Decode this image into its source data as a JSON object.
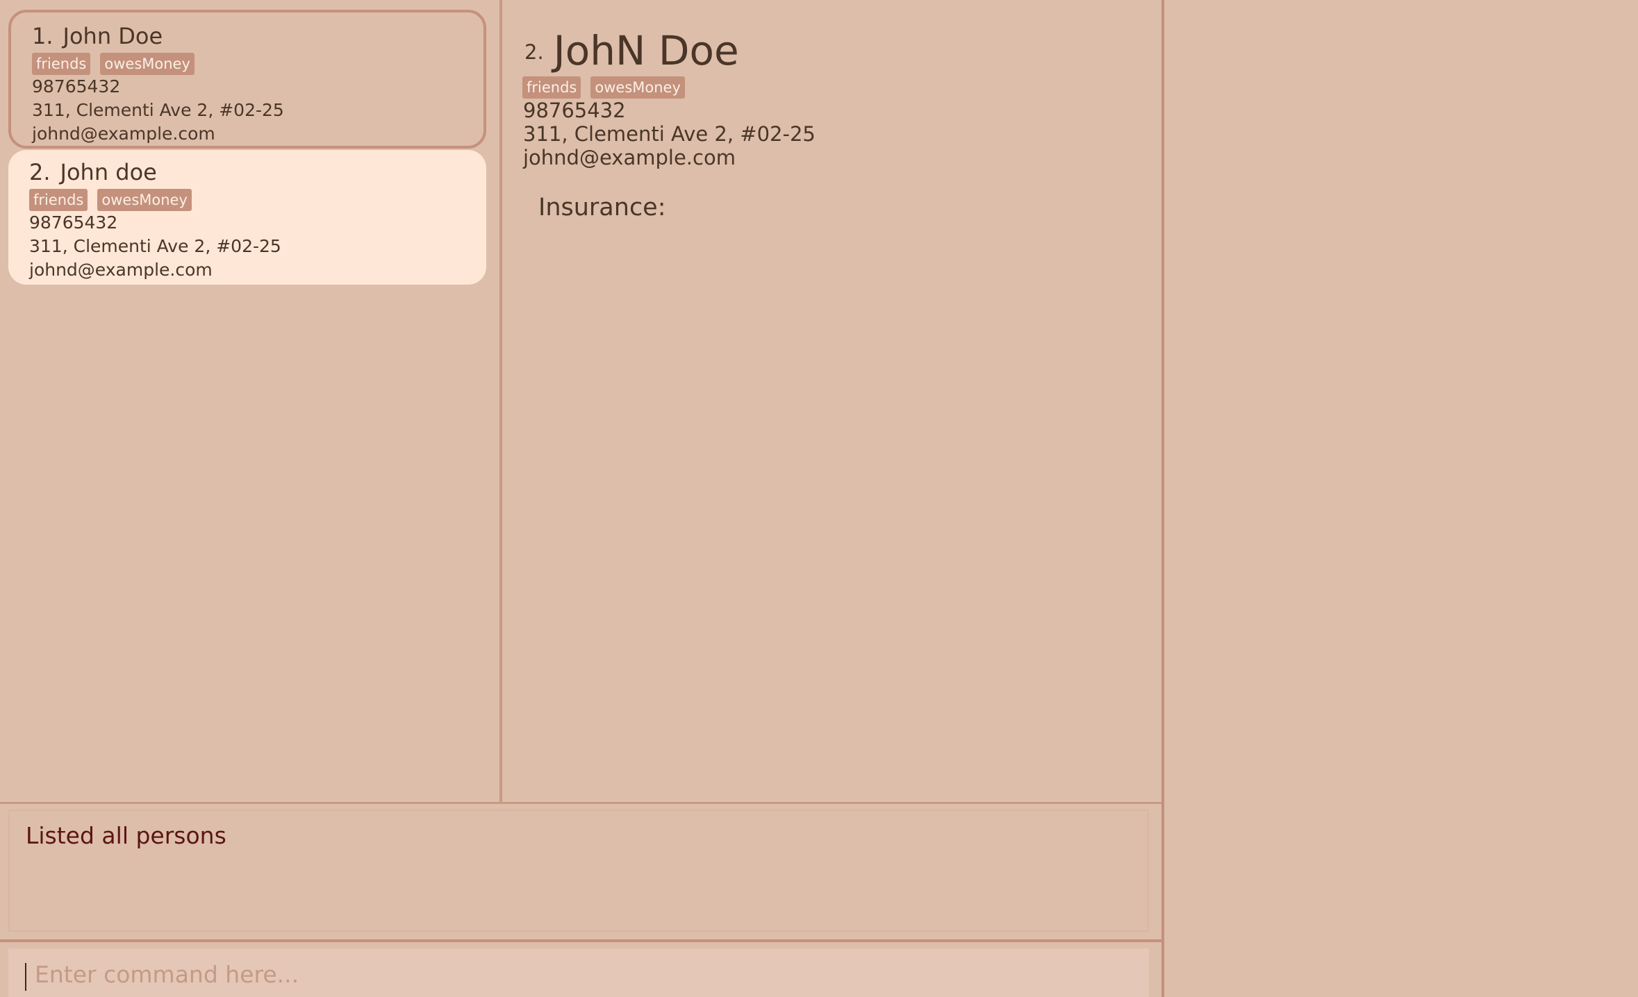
{
  "person_list": {
    "persons": [
      {
        "index": "1.",
        "name": "John Doe",
        "tags": [
          "friends",
          "owesMoney"
        ],
        "phone": "98765432",
        "address": "311, Clementi Ave 2, #02-25",
        "email": "johnd@example.com"
      },
      {
        "index": "2.",
        "name": "John doe",
        "tags": [
          "friends",
          "owesMoney"
        ],
        "phone": "98765432",
        "address": "311, Clementi Ave 2, #02-25",
        "email": "johnd@example.com"
      }
    ]
  },
  "detail": {
    "index": "2.",
    "name": "JohN Doe",
    "tags": [
      "friends",
      "owesMoney"
    ],
    "phone": "98765432",
    "address": "311, Clementi Ave 2, #02-25",
    "email": "johnd@example.com",
    "insurance_label": "Insurance:"
  },
  "result_display": {
    "text": "Listed all persons"
  },
  "command_box": {
    "placeholder": "Enter command here...",
    "value": ""
  },
  "colors": {
    "background": "#ddbeaa",
    "selected_card": "#fee7d6",
    "tag_background": "#c4917c",
    "result_text": "#5b1414"
  }
}
